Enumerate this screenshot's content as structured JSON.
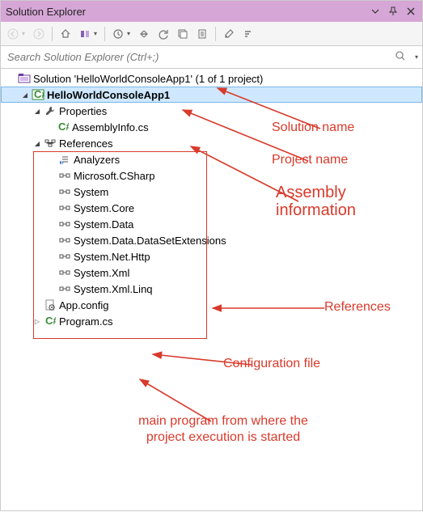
{
  "titlebar": {
    "title": "Solution Explorer"
  },
  "search": {
    "placeholder": "Search Solution Explorer (Ctrl+;)"
  },
  "tree": {
    "solution": "Solution 'HelloWorldConsoleApp1' (1 of 1 project)",
    "project": "HelloWorldConsoleApp1",
    "properties": "Properties",
    "assemblyinfo": "AssemblyInfo.cs",
    "references": "References",
    "refs": {
      "analyzers": "Analyzers",
      "r1": "Microsoft.CSharp",
      "r2": "System",
      "r3": "System.Core",
      "r4": "System.Data",
      "r5": "System.Data.DataSetExtensions",
      "r6": "System.Net.Http",
      "r7": "System.Xml",
      "r8": "System.Xml.Linq"
    },
    "appconfig": "App.config",
    "program": "Program.cs"
  },
  "annotations": {
    "solutionName": "Solution name",
    "projectName": "Project name",
    "assemblyInfo": "Assembly information",
    "references": "References",
    "configFile": "Configuration file",
    "mainProgram": "main program from where the project execution is started"
  }
}
